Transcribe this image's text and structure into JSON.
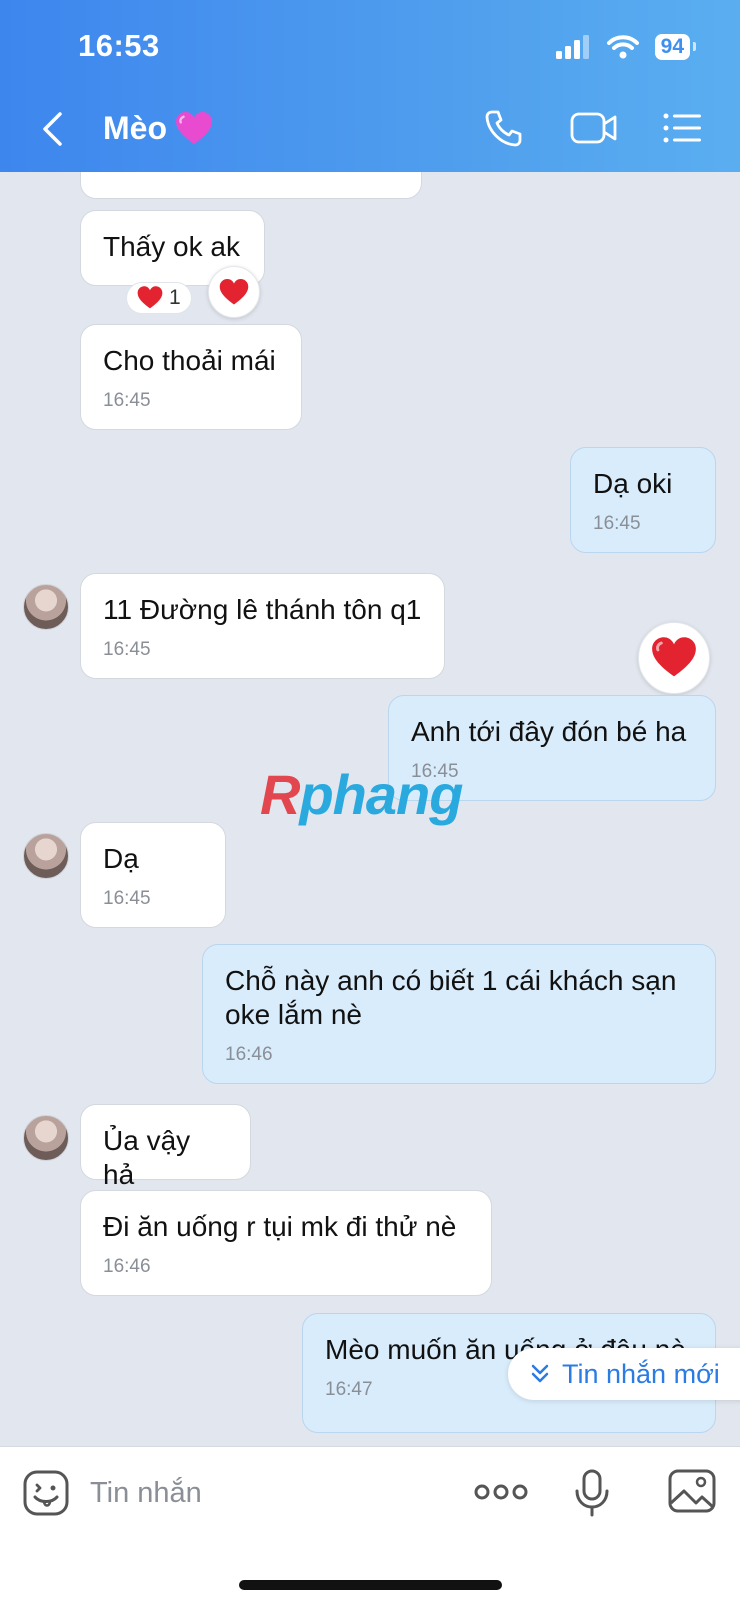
{
  "status_bar": {
    "time": "16:53",
    "battery": "94"
  },
  "header": {
    "title": "Mèo"
  },
  "messages": [
    {
      "text": "Thấy ok ak",
      "reaction_count": "1"
    },
    {
      "text": "Cho thoải mái",
      "time": "16:45"
    },
    {
      "text": "Dạ oki",
      "time": "16:45"
    },
    {
      "text": "11 Đường lê thánh tôn q1",
      "time": "16:45"
    },
    {
      "text": "Anh tới đây đón bé ha",
      "time": "16:45"
    },
    {
      "text": "Dạ",
      "time": "16:45"
    },
    {
      "text": "Chỗ này anh có biết 1 cái khách sạn oke lắm nè",
      "time": "16:46"
    },
    {
      "text": "Ủa vậy hả"
    },
    {
      "text": "Đi ăn uống r tụi mk đi thử nè",
      "time": "16:46"
    },
    {
      "text": "Mèo muốn ăn uống ở đâu nè",
      "time": "16:47"
    }
  ],
  "watermark": {
    "first": "R",
    "rest": "phang"
  },
  "new_messages_label": "Tin nhắn mới",
  "composer": {
    "placeholder": "Tin nhắn"
  }
}
